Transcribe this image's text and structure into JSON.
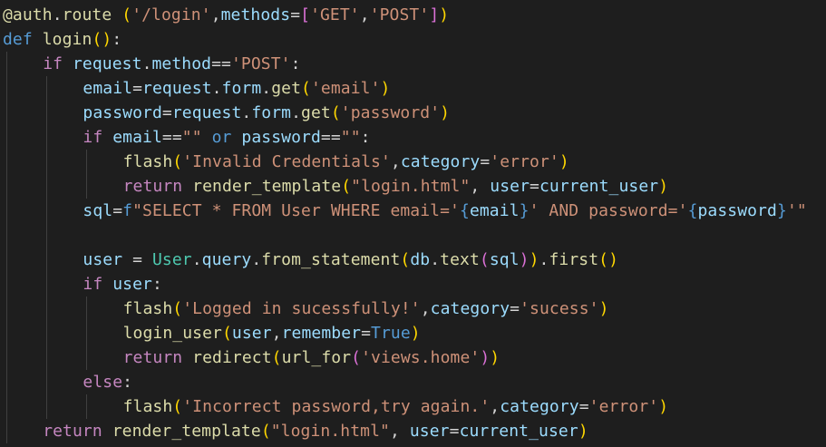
{
  "colors": {
    "background": "#1e1e1e",
    "default": "#d4d4d4",
    "keyword_control": "#c586c0",
    "keyword_storage": "#569cd6",
    "function": "#dcdcaa",
    "variable": "#9cdcfe",
    "string": "#ce9178",
    "class": "#4ec9b0",
    "bracket_gold": "#ffd700",
    "bracket_purple": "#da70d6",
    "bracket_blue": "#179fff",
    "indent_guide": "#404040"
  },
  "code_lines": [
    {
      "indent": 0,
      "tokens": [
        {
          "t": "@auth",
          "c": "function"
        },
        {
          "t": ".",
          "c": "default"
        },
        {
          "t": "route",
          "c": "function"
        },
        {
          "t": " ",
          "c": "default"
        },
        {
          "t": "(",
          "c": "bracket_gold"
        },
        {
          "t": "'/login'",
          "c": "string"
        },
        {
          "t": ",",
          "c": "default"
        },
        {
          "t": "methods",
          "c": "variable"
        },
        {
          "t": "=",
          "c": "default"
        },
        {
          "t": "[",
          "c": "bracket_purple"
        },
        {
          "t": "'GET'",
          "c": "string"
        },
        {
          "t": ",",
          "c": "default"
        },
        {
          "t": "'POST'",
          "c": "string"
        },
        {
          "t": "]",
          "c": "bracket_purple"
        },
        {
          "t": ")",
          "c": "bracket_gold"
        }
      ]
    },
    {
      "indent": 0,
      "tokens": [
        {
          "t": "def",
          "c": "keyword_storage"
        },
        {
          "t": " ",
          "c": "default"
        },
        {
          "t": "login",
          "c": "function"
        },
        {
          "t": "()",
          "c": "bracket_gold"
        },
        {
          "t": ":",
          "c": "default"
        }
      ]
    },
    {
      "indent": 1,
      "tokens": [
        {
          "t": "if",
          "c": "keyword_control"
        },
        {
          "t": " ",
          "c": "default"
        },
        {
          "t": "request",
          "c": "variable"
        },
        {
          "t": ".",
          "c": "default"
        },
        {
          "t": "method",
          "c": "variable"
        },
        {
          "t": "==",
          "c": "default"
        },
        {
          "t": "'POST'",
          "c": "string"
        },
        {
          "t": ":",
          "c": "default"
        }
      ]
    },
    {
      "indent": 2,
      "tokens": [
        {
          "t": "email",
          "c": "variable"
        },
        {
          "t": "=",
          "c": "default"
        },
        {
          "t": "request",
          "c": "variable"
        },
        {
          "t": ".",
          "c": "default"
        },
        {
          "t": "form",
          "c": "variable"
        },
        {
          "t": ".",
          "c": "default"
        },
        {
          "t": "get",
          "c": "function"
        },
        {
          "t": "(",
          "c": "bracket_gold"
        },
        {
          "t": "'email'",
          "c": "string"
        },
        {
          "t": ")",
          "c": "bracket_gold"
        }
      ]
    },
    {
      "indent": 2,
      "tokens": [
        {
          "t": "password",
          "c": "variable"
        },
        {
          "t": "=",
          "c": "default"
        },
        {
          "t": "request",
          "c": "variable"
        },
        {
          "t": ".",
          "c": "default"
        },
        {
          "t": "form",
          "c": "variable"
        },
        {
          "t": ".",
          "c": "default"
        },
        {
          "t": "get",
          "c": "function"
        },
        {
          "t": "(",
          "c": "bracket_gold"
        },
        {
          "t": "'password'",
          "c": "string"
        },
        {
          "t": ")",
          "c": "bracket_gold"
        }
      ]
    },
    {
      "indent": 2,
      "tokens": [
        {
          "t": "if",
          "c": "keyword_control"
        },
        {
          "t": " ",
          "c": "default"
        },
        {
          "t": "email",
          "c": "variable"
        },
        {
          "t": "==",
          "c": "default"
        },
        {
          "t": "\"\"",
          "c": "string"
        },
        {
          "t": " ",
          "c": "default"
        },
        {
          "t": "or",
          "c": "keyword_storage"
        },
        {
          "t": " ",
          "c": "default"
        },
        {
          "t": "password",
          "c": "variable"
        },
        {
          "t": "==",
          "c": "default"
        },
        {
          "t": "\"\"",
          "c": "string"
        },
        {
          "t": ":",
          "c": "default"
        }
      ]
    },
    {
      "indent": 3,
      "tokens": [
        {
          "t": "flash",
          "c": "function"
        },
        {
          "t": "(",
          "c": "bracket_gold"
        },
        {
          "t": "'Invalid Credentials'",
          "c": "string"
        },
        {
          "t": ",",
          "c": "default"
        },
        {
          "t": "category",
          "c": "variable"
        },
        {
          "t": "=",
          "c": "default"
        },
        {
          "t": "'error'",
          "c": "string"
        },
        {
          "t": ")",
          "c": "bracket_gold"
        }
      ]
    },
    {
      "indent": 3,
      "tokens": [
        {
          "t": "return",
          "c": "keyword_control"
        },
        {
          "t": " ",
          "c": "default"
        },
        {
          "t": "render_template",
          "c": "function"
        },
        {
          "t": "(",
          "c": "bracket_gold"
        },
        {
          "t": "\"login.html\"",
          "c": "string"
        },
        {
          "t": ", ",
          "c": "default"
        },
        {
          "t": "user",
          "c": "variable"
        },
        {
          "t": "=",
          "c": "default"
        },
        {
          "t": "current_user",
          "c": "variable"
        },
        {
          "t": ")",
          "c": "bracket_gold"
        }
      ]
    },
    {
      "indent": 2,
      "tokens": [
        {
          "t": "sql",
          "c": "variable"
        },
        {
          "t": "=",
          "c": "default"
        },
        {
          "t": "f",
          "c": "keyword_storage"
        },
        {
          "t": "\"SELECT * FROM User WHERE email='",
          "c": "string"
        },
        {
          "t": "{",
          "c": "keyword_storage"
        },
        {
          "t": "email",
          "c": "variable"
        },
        {
          "t": "}",
          "c": "keyword_storage"
        },
        {
          "t": "' AND password='",
          "c": "string"
        },
        {
          "t": "{",
          "c": "keyword_storage"
        },
        {
          "t": "password",
          "c": "variable"
        },
        {
          "t": "}",
          "c": "keyword_storage"
        },
        {
          "t": "'\"",
          "c": "string"
        }
      ]
    },
    {
      "indent": 2,
      "tokens": []
    },
    {
      "indent": 2,
      "tokens": [
        {
          "t": "user",
          "c": "variable"
        },
        {
          "t": " = ",
          "c": "default"
        },
        {
          "t": "User",
          "c": "class"
        },
        {
          "t": ".",
          "c": "default"
        },
        {
          "t": "query",
          "c": "variable"
        },
        {
          "t": ".",
          "c": "default"
        },
        {
          "t": "from_statement",
          "c": "function"
        },
        {
          "t": "(",
          "c": "bracket_gold"
        },
        {
          "t": "db",
          "c": "variable"
        },
        {
          "t": ".",
          "c": "default"
        },
        {
          "t": "text",
          "c": "function"
        },
        {
          "t": "(",
          "c": "bracket_purple"
        },
        {
          "t": "sql",
          "c": "variable"
        },
        {
          "t": ")",
          "c": "bracket_purple"
        },
        {
          "t": ")",
          "c": "bracket_gold"
        },
        {
          "t": ".",
          "c": "default"
        },
        {
          "t": "first",
          "c": "function"
        },
        {
          "t": "()",
          "c": "bracket_gold"
        }
      ]
    },
    {
      "indent": 2,
      "tokens": [
        {
          "t": "if",
          "c": "keyword_control"
        },
        {
          "t": " ",
          "c": "default"
        },
        {
          "t": "user",
          "c": "variable"
        },
        {
          "t": ":",
          "c": "default"
        }
      ]
    },
    {
      "indent": 3,
      "tokens": [
        {
          "t": "flash",
          "c": "function"
        },
        {
          "t": "(",
          "c": "bracket_gold"
        },
        {
          "t": "'Logged in sucessfully!'",
          "c": "string"
        },
        {
          "t": ",",
          "c": "default"
        },
        {
          "t": "category",
          "c": "variable"
        },
        {
          "t": "=",
          "c": "default"
        },
        {
          "t": "'sucess'",
          "c": "string"
        },
        {
          "t": ")",
          "c": "bracket_gold"
        }
      ]
    },
    {
      "indent": 3,
      "tokens": [
        {
          "t": "login_user",
          "c": "function"
        },
        {
          "t": "(",
          "c": "bracket_gold"
        },
        {
          "t": "user",
          "c": "variable"
        },
        {
          "t": ",",
          "c": "default"
        },
        {
          "t": "remember",
          "c": "variable"
        },
        {
          "t": "=",
          "c": "default"
        },
        {
          "t": "True",
          "c": "keyword_storage"
        },
        {
          "t": ")",
          "c": "bracket_gold"
        }
      ]
    },
    {
      "indent": 3,
      "tokens": [
        {
          "t": "return",
          "c": "keyword_control"
        },
        {
          "t": " ",
          "c": "default"
        },
        {
          "t": "redirect",
          "c": "function"
        },
        {
          "t": "(",
          "c": "bracket_gold"
        },
        {
          "t": "url_for",
          "c": "function"
        },
        {
          "t": "(",
          "c": "bracket_purple"
        },
        {
          "t": "'views.home'",
          "c": "string"
        },
        {
          "t": ")",
          "c": "bracket_purple"
        },
        {
          "t": ")",
          "c": "bracket_gold"
        }
      ]
    },
    {
      "indent": 2,
      "tokens": [
        {
          "t": "else",
          "c": "keyword_control"
        },
        {
          "t": ":",
          "c": "default"
        }
      ]
    },
    {
      "indent": 3,
      "tokens": [
        {
          "t": "flash",
          "c": "function"
        },
        {
          "t": "(",
          "c": "bracket_gold"
        },
        {
          "t": "'Incorrect password,try again.'",
          "c": "string"
        },
        {
          "t": ",",
          "c": "default"
        },
        {
          "t": "category",
          "c": "variable"
        },
        {
          "t": "=",
          "c": "default"
        },
        {
          "t": "'error'",
          "c": "string"
        },
        {
          "t": ")",
          "c": "bracket_gold"
        }
      ]
    },
    {
      "indent": 1,
      "tokens": [
        {
          "t": "return",
          "c": "keyword_control"
        },
        {
          "t": " ",
          "c": "default"
        },
        {
          "t": "render_template",
          "c": "function"
        },
        {
          "t": "(",
          "c": "bracket_gold"
        },
        {
          "t": "\"login.html\"",
          "c": "string"
        },
        {
          "t": ", ",
          "c": "default"
        },
        {
          "t": "user",
          "c": "variable"
        },
        {
          "t": "=",
          "c": "default"
        },
        {
          "t": "current_user",
          "c": "variable"
        },
        {
          "t": ")",
          "c": "bracket_gold"
        }
      ]
    }
  ]
}
